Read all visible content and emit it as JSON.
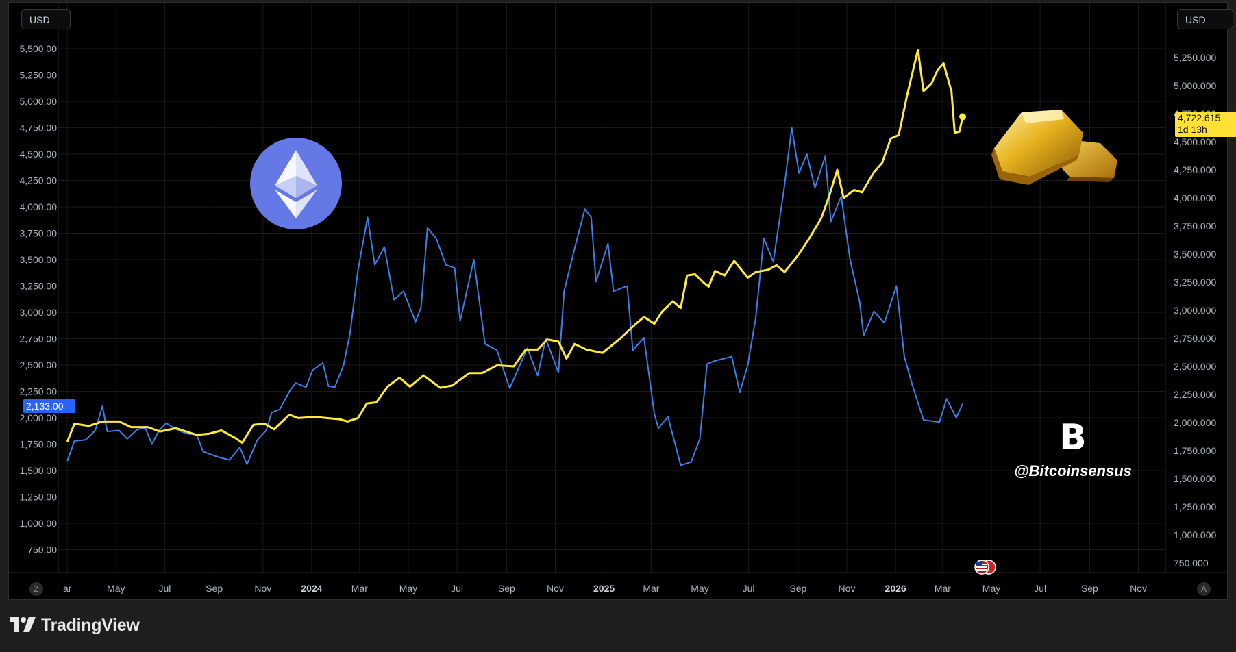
{
  "currency_left": "USD",
  "currency_right": "USD",
  "corner_left": "Z",
  "corner_right": "A",
  "footer_brand": "TradingView",
  "watermark": {
    "symbol": "B",
    "handle": "@Bitcoinsensus"
  },
  "icons": {
    "ethereum": "ethereum-logo-icon",
    "gold": "gold-bars-icon",
    "flag": "us-flag-icon",
    "brand": "bitcoinsensus-logo-icon",
    "tradingview": "tradingview-logo-icon"
  },
  "chart_data": {
    "type": "line",
    "x_ticks": [
      {
        "label": "ar",
        "x": "2023-03"
      },
      {
        "label": "May",
        "x": "2023-05"
      },
      {
        "label": "Jul",
        "x": "2023-07"
      },
      {
        "label": "Sep",
        "x": "2023-09"
      },
      {
        "label": "Nov",
        "x": "2023-11"
      },
      {
        "label": "2024",
        "x": "2024-01",
        "bold": true
      },
      {
        "label": "Mar",
        "x": "2024-03"
      },
      {
        "label": "May",
        "x": "2024-05"
      },
      {
        "label": "Jul",
        "x": "2024-07"
      },
      {
        "label": "Sep",
        "x": "2024-09"
      },
      {
        "label": "Nov",
        "x": "2024-11"
      },
      {
        "label": "2025",
        "x": "2025-01",
        "bold": true
      },
      {
        "label": "Mar",
        "x": "2025-03"
      },
      {
        "label": "May",
        "x": "2025-05"
      },
      {
        "label": "Jul",
        "x": "2025-07"
      },
      {
        "label": "Sep",
        "x": "2025-09"
      },
      {
        "label": "Nov",
        "x": "2025-11"
      },
      {
        "label": "2026",
        "x": "2026-01",
        "bold": true
      },
      {
        "label": "Mar",
        "x": "2026-03"
      },
      {
        "label": "May",
        "x": "2026-05"
      },
      {
        "label": "Jul",
        "x": "2026-07"
      },
      {
        "label": "Sep",
        "x": "2026-09"
      },
      {
        "label": "Nov",
        "x": "2026-11"
      }
    ],
    "left_axis": {
      "ticks": [
        "5,500.00",
        "5,250.00",
        "5,000.00",
        "4,750.00",
        "4,500.00",
        "4,250.00",
        "4,000.00",
        "3,750.00",
        "3,500.00",
        "3,250.00",
        "3,000.00",
        "2,750.00",
        "2,500.00",
        "2,250.00",
        "2,000.00",
        "1,750.00",
        "1,500.00",
        "1,250.00",
        "1,000.00",
        "750.00"
      ],
      "values": [
        5500,
        5250,
        5000,
        4750,
        4500,
        4250,
        4000,
        3750,
        3500,
        3250,
        3000,
        2750,
        2500,
        2250,
        2000,
        1750,
        1500,
        1250,
        1000,
        750
      ]
    },
    "right_axis": {
      "ticks": [
        "5,250.000",
        "5,000.000",
        "4,750.000",
        "4,500.000",
        "4,250.000",
        "4,000.000",
        "3,750.000",
        "3,500.000",
        "3,250.000",
        "3,000.000",
        "2,750.000",
        "2,500.000",
        "2,250.000",
        "2,000.000",
        "1,750.000",
        "1,500.000",
        "1,250.000",
        "1,000.000",
        "750.000"
      ],
      "values": [
        5250,
        5000,
        4750,
        4500,
        4250,
        4000,
        3750,
        3500,
        3250,
        3000,
        2750,
        2500,
        2250,
        2000,
        1750,
        1500,
        1250,
        1000,
        750
      ]
    },
    "series": [
      {
        "key": "eth",
        "axis": "left",
        "color": "#3f7fe8",
        "last_label": "2,133.00",
        "points": [
          [
            "2023-03-01",
            1590
          ],
          [
            "2023-03-10",
            1780
          ],
          [
            "2023-03-24",
            1790
          ],
          [
            "2023-04-05",
            1880
          ],
          [
            "2023-04-14",
            2110
          ],
          [
            "2023-04-20",
            1870
          ],
          [
            "2023-05-05",
            1880
          ],
          [
            "2023-05-15",
            1800
          ],
          [
            "2023-05-28",
            1890
          ],
          [
            "2023-06-07",
            1900
          ],
          [
            "2023-06-15",
            1750
          ],
          [
            "2023-06-24",
            1880
          ],
          [
            "2023-07-03",
            1950
          ],
          [
            "2023-07-13",
            1900
          ],
          [
            "2023-07-28",
            1850
          ],
          [
            "2023-08-10",
            1840
          ],
          [
            "2023-08-18",
            1680
          ],
          [
            "2023-09-05",
            1630
          ],
          [
            "2023-09-20",
            1600
          ],
          [
            "2023-10-03",
            1720
          ],
          [
            "2023-10-12",
            1560
          ],
          [
            "2023-10-25",
            1790
          ],
          [
            "2023-11-05",
            1880
          ],
          [
            "2023-11-12",
            2050
          ],
          [
            "2023-11-22",
            2080
          ],
          [
            "2023-12-05",
            2260
          ],
          [
            "2023-12-12",
            2330
          ],
          [
            "2023-12-25",
            2290
          ],
          [
            "2024-01-02",
            2450
          ],
          [
            "2024-01-15",
            2520
          ],
          [
            "2024-01-22",
            2300
          ],
          [
            "2024-01-30",
            2290
          ],
          [
            "2024-02-10",
            2500
          ],
          [
            "2024-02-18",
            2800
          ],
          [
            "2024-02-28",
            3400
          ],
          [
            "2024-03-11",
            3900
          ],
          [
            "2024-03-20",
            3450
          ],
          [
            "2024-04-01",
            3620
          ],
          [
            "2024-04-13",
            3120
          ],
          [
            "2024-04-25",
            3200
          ],
          [
            "2024-05-10",
            2910
          ],
          [
            "2024-05-17",
            3050
          ],
          [
            "2024-05-25",
            3800
          ],
          [
            "2024-06-05",
            3700
          ],
          [
            "2024-06-17",
            3450
          ],
          [
            "2024-06-28",
            3420
          ],
          [
            "2024-07-05",
            2920
          ],
          [
            "2024-07-22",
            3500
          ],
          [
            "2024-08-05",
            2700
          ],
          [
            "2024-08-20",
            2640
          ],
          [
            "2024-09-05",
            2280
          ],
          [
            "2024-09-13",
            2420
          ],
          [
            "2024-09-27",
            2660
          ],
          [
            "2024-10-10",
            2400
          ],
          [
            "2024-10-20",
            2750
          ],
          [
            "2024-11-05",
            2430
          ],
          [
            "2024-11-12",
            3200
          ],
          [
            "2024-11-25",
            3600
          ],
          [
            "2024-12-08",
            3980
          ],
          [
            "2024-12-16",
            3900
          ],
          [
            "2024-12-22",
            3290
          ],
          [
            "2025-01-06",
            3650
          ],
          [
            "2025-01-13",
            3200
          ],
          [
            "2025-01-30",
            3250
          ],
          [
            "2025-02-06",
            2640
          ],
          [
            "2025-02-20",
            2760
          ],
          [
            "2025-03-05",
            2040
          ],
          [
            "2025-03-10",
            1900
          ],
          [
            "2025-03-22",
            2010
          ],
          [
            "2025-04-07",
            1550
          ],
          [
            "2025-04-20",
            1580
          ],
          [
            "2025-05-01",
            1800
          ],
          [
            "2025-05-10",
            2510
          ],
          [
            "2025-05-20",
            2540
          ],
          [
            "2025-06-10",
            2580
          ],
          [
            "2025-06-20",
            2240
          ],
          [
            "2025-06-30",
            2500
          ],
          [
            "2025-07-10",
            2950
          ],
          [
            "2025-07-20",
            3700
          ],
          [
            "2025-08-01",
            3480
          ],
          [
            "2025-08-14",
            4150
          ],
          [
            "2025-08-24",
            4750
          ],
          [
            "2025-09-02",
            4320
          ],
          [
            "2025-09-12",
            4500
          ],
          [
            "2025-09-22",
            4180
          ],
          [
            "2025-10-05",
            4480
          ],
          [
            "2025-10-12",
            3860
          ],
          [
            "2025-10-25",
            4100
          ],
          [
            "2025-11-05",
            3500
          ],
          [
            "2025-11-17",
            3100
          ],
          [
            "2025-11-22",
            2780
          ],
          [
            "2025-12-05",
            3010
          ],
          [
            "2025-12-18",
            2900
          ],
          [
            "2026-01-02",
            3250
          ],
          [
            "2026-01-12",
            2580
          ],
          [
            "2026-01-22",
            2310
          ],
          [
            "2026-02-05",
            1980
          ],
          [
            "2026-02-25",
            1960
          ],
          [
            "2026-03-06",
            2180
          ],
          [
            "2026-03-18",
            2000
          ],
          [
            "2026-03-26",
            2133
          ]
        ]
      },
      {
        "key": "gold",
        "axis": "right",
        "color": "#ffeb3b",
        "last_label": "4,722.615",
        "last_sublabel": "1d 13h",
        "points": [
          [
            "2023-03-01",
            1830
          ],
          [
            "2023-03-10",
            1990
          ],
          [
            "2023-03-28",
            1970
          ],
          [
            "2023-04-14",
            2010
          ],
          [
            "2023-05-05",
            2010
          ],
          [
            "2023-05-20",
            1960
          ],
          [
            "2023-06-10",
            1960
          ],
          [
            "2023-06-25",
            1920
          ],
          [
            "2023-07-15",
            1950
          ],
          [
            "2023-08-10",
            1890
          ],
          [
            "2023-08-25",
            1900
          ],
          [
            "2023-09-10",
            1930
          ],
          [
            "2023-09-28",
            1860
          ],
          [
            "2023-10-06",
            1820
          ],
          [
            "2023-10-20",
            1980
          ],
          [
            "2023-11-03",
            1990
          ],
          [
            "2023-11-15",
            1940
          ],
          [
            "2023-11-25",
            2010
          ],
          [
            "2023-12-04",
            2070
          ],
          [
            "2023-12-15",
            2040
          ],
          [
            "2024-01-05",
            2050
          ],
          [
            "2024-02-05",
            2030
          ],
          [
            "2024-02-15",
            2010
          ],
          [
            "2024-02-28",
            2040
          ],
          [
            "2024-03-10",
            2170
          ],
          [
            "2024-03-22",
            2180
          ],
          [
            "2024-04-05",
            2320
          ],
          [
            "2024-04-20",
            2400
          ],
          [
            "2024-05-03",
            2320
          ],
          [
            "2024-05-20",
            2420
          ],
          [
            "2024-06-10",
            2310
          ],
          [
            "2024-06-25",
            2330
          ],
          [
            "2024-07-16",
            2440
          ],
          [
            "2024-08-01",
            2440
          ],
          [
            "2024-08-20",
            2510
          ],
          [
            "2024-09-10",
            2500
          ],
          [
            "2024-09-25",
            2650
          ],
          [
            "2024-10-10",
            2650
          ],
          [
            "2024-10-22",
            2740
          ],
          [
            "2024-11-05",
            2720
          ],
          [
            "2024-11-15",
            2570
          ],
          [
            "2024-11-25",
            2700
          ],
          [
            "2024-12-10",
            2650
          ],
          [
            "2024-12-30",
            2620
          ],
          [
            "2025-01-20",
            2740
          ],
          [
            "2025-02-10",
            2880
          ],
          [
            "2025-02-20",
            2940
          ],
          [
            "2025-03-05",
            2880
          ],
          [
            "2025-03-15",
            2990
          ],
          [
            "2025-03-28",
            3080
          ],
          [
            "2025-04-07",
            3020
          ],
          [
            "2025-04-15",
            3310
          ],
          [
            "2025-04-25",
            3320
          ],
          [
            "2025-05-05",
            3250
          ],
          [
            "2025-05-12",
            3210
          ],
          [
            "2025-05-20",
            3350
          ],
          [
            "2025-06-01",
            3310
          ],
          [
            "2025-06-13",
            3440
          ],
          [
            "2025-06-30",
            3290
          ],
          [
            "2025-07-10",
            3340
          ],
          [
            "2025-07-25",
            3360
          ],
          [
            "2025-08-05",
            3400
          ],
          [
            "2025-08-15",
            3340
          ],
          [
            "2025-09-01",
            3490
          ],
          [
            "2025-09-15",
            3640
          ],
          [
            "2025-09-30",
            3820
          ],
          [
            "2025-10-10",
            4020
          ],
          [
            "2025-10-20",
            4250
          ],
          [
            "2025-10-28",
            4000
          ],
          [
            "2025-11-10",
            4070
          ],
          [
            "2025-11-20",
            4050
          ],
          [
            "2025-12-05",
            4230
          ],
          [
            "2025-12-15",
            4310
          ],
          [
            "2025-12-26",
            4530
          ],
          [
            "2026-01-05",
            4560
          ],
          [
            "2026-01-15",
            4900
          ],
          [
            "2026-01-29",
            5320
          ],
          [
            "2026-02-05",
            4950
          ],
          [
            "2026-02-15",
            5020
          ],
          [
            "2026-02-22",
            5130
          ],
          [
            "2026-03-02",
            5200
          ],
          [
            "2026-03-06",
            5100
          ],
          [
            "2026-03-12",
            4950
          ],
          [
            "2026-03-16",
            4580
          ],
          [
            "2026-03-22",
            4590
          ],
          [
            "2026-03-26",
            4723
          ]
        ]
      }
    ]
  }
}
